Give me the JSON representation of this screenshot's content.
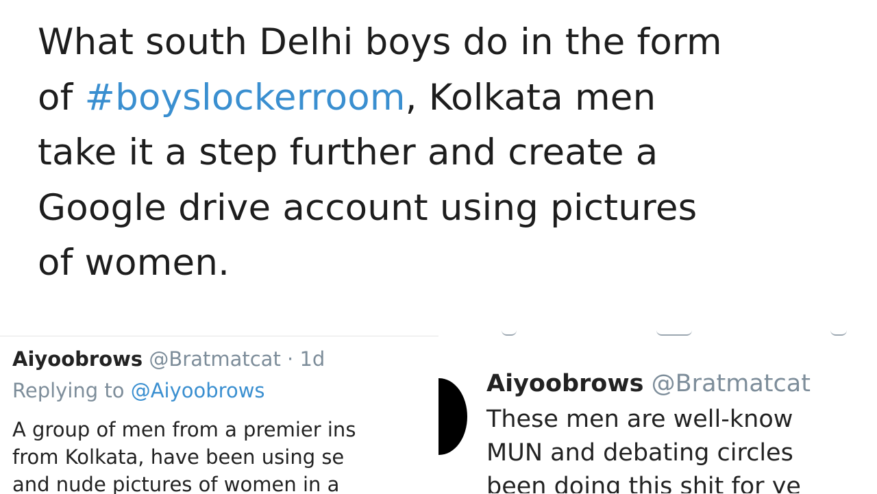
{
  "main_tweet": {
    "line1": "What south Delhi boys do in the form",
    "line2_prefix": "of ",
    "hashtag": "#boyslockerroom",
    "line2_suffix": ", Kolkata men",
    "line3": "take it a step further and create a",
    "line4": "Google drive account using pictures",
    "line5": "of women."
  },
  "left_reply": {
    "name": "Aiyoobrows",
    "handle": "@Bratmatcat",
    "time": "· 1d",
    "replying_prefix": "Replying to ",
    "replying_to": "@Aiyoobrows",
    "body": [
      "A group of men from a premier ins",
      "from Kolkata, have been using se",
      "and nude pictures of women in a"
    ]
  },
  "right_reply": {
    "name": "Aiyoobrows",
    "handle": "@Bratmatcat",
    "body": [
      "These men are well-know",
      "MUN and debating circles",
      "been doing this shit for ye"
    ]
  },
  "colors": {
    "hashtag": "#3a8fd0",
    "handle_gray": "#7d8d9a",
    "text": "#1d1d1d"
  }
}
